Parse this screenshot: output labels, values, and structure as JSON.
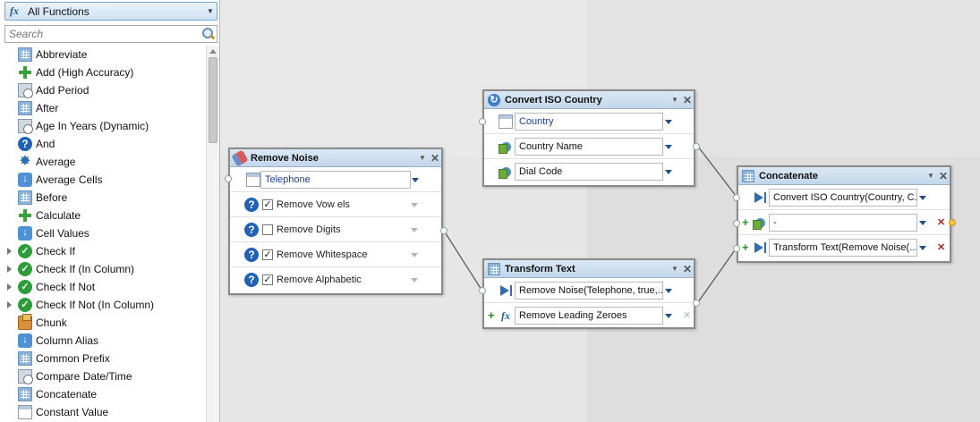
{
  "sidebar": {
    "filter_label": "All Functions",
    "search_placeholder": "Search",
    "items": [
      {
        "label": "Abbreviate",
        "icon": "grid-icon",
        "expandable": false
      },
      {
        "label": "Add (High Accuracy)",
        "icon": "plus-icon",
        "expandable": false
      },
      {
        "label": "Add Period",
        "icon": "calendar-clock-icon",
        "expandable": false
      },
      {
        "label": "After",
        "icon": "grid-icon",
        "expandable": false
      },
      {
        "label": "Age In Years (Dynamic)",
        "icon": "calendar-clock-icon",
        "expandable": false
      },
      {
        "label": "And",
        "icon": "question-icon",
        "expandable": false
      },
      {
        "label": "Average",
        "icon": "starburst-icon",
        "expandable": false
      },
      {
        "label": "Average Cells",
        "icon": "download-arrow-icon",
        "expandable": false
      },
      {
        "label": "Before",
        "icon": "grid-icon",
        "expandable": false
      },
      {
        "label": "Calculate",
        "icon": "plus-icon",
        "expandable": false
      },
      {
        "label": "Cell Values",
        "icon": "download-arrow-icon",
        "expandable": false
      },
      {
        "label": "Check If",
        "icon": "check-circle-icon",
        "expandable": true
      },
      {
        "label": "Check If (In Column)",
        "icon": "check-circle-icon",
        "expandable": true
      },
      {
        "label": "Check If Not",
        "icon": "check-circle-icon",
        "expandable": true
      },
      {
        "label": "Check If Not (In Column)",
        "icon": "check-circle-icon",
        "expandable": true
      },
      {
        "label": "Chunk",
        "icon": "chunk-icon",
        "expandable": false
      },
      {
        "label": "Column Alias",
        "icon": "download-arrow-icon",
        "expandable": false
      },
      {
        "label": "Common Prefix",
        "icon": "grid-icon",
        "expandable": false
      },
      {
        "label": "Compare Date/Time",
        "icon": "calendar-clock-icon",
        "expandable": false
      },
      {
        "label": "Concatenate",
        "icon": "grid-icon",
        "expandable": false
      },
      {
        "label": "Constant Value",
        "icon": "table-icon",
        "expandable": false
      }
    ]
  },
  "nodes": {
    "remove_noise": {
      "title": "Remove Noise",
      "input": "Telephone",
      "options": [
        {
          "label": "Remove Vow els",
          "checked": true
        },
        {
          "label": "Remove Digits",
          "checked": false
        },
        {
          "label": "Remove Whitespace",
          "checked": true
        },
        {
          "label": "Remove Alphabetic",
          "checked": true
        }
      ]
    },
    "convert_iso": {
      "title": "Convert ISO Country",
      "rows": [
        {
          "value": "Country",
          "icon": "table-icon"
        },
        {
          "value": "Country Name",
          "icon": "globe-icon"
        },
        {
          "value": "Dial Code",
          "icon": "globe-icon"
        }
      ]
    },
    "transform_text": {
      "title": "Transform Text",
      "rows": [
        {
          "value": "Remove Noise(Telephone, true,...",
          "icon": "play-icon"
        },
        {
          "value": "Remove Leading Zeroes",
          "icon": "fx-icon"
        }
      ]
    },
    "concatenate": {
      "title": "Concatenate",
      "rows": [
        {
          "value": "Convert ISO Country(Country, C...",
          "icon": "play-icon"
        },
        {
          "value": "-",
          "icon": "globe-icon"
        },
        {
          "value": "Transform Text(Remove Noise(...",
          "icon": "play-icon"
        }
      ]
    }
  },
  "colors": {
    "header_blue": "#c3d6ea",
    "link_text": "#1a3fa3",
    "wire": "#555555",
    "remove_red": "#a52a2a",
    "add_green": "#2f8f2f"
  }
}
